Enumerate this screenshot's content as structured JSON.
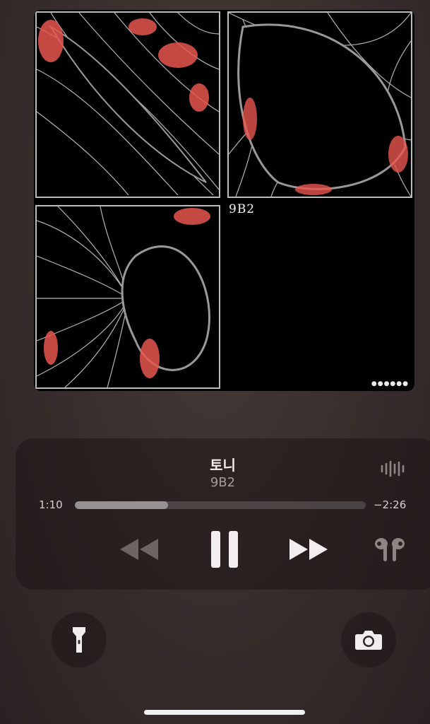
{
  "artwork": {
    "label": "9B2",
    "corner_mark": "●●●●●●"
  },
  "now_playing": {
    "title": "토니",
    "artist": "9B2",
    "elapsed": "1:10",
    "remaining": "−2:26",
    "progress_fraction": 0.32,
    "state": "playing"
  },
  "icons": {
    "audio": "waveform-icon",
    "rewind": "backward-icon",
    "play_pause": "pause-icon",
    "forward": "forward-icon",
    "output": "airpods-icon",
    "flashlight": "flashlight-icon",
    "camera": "camera-icon"
  },
  "colors": {
    "art_accent": "#e8564f",
    "art_line": "#c8c8c8"
  }
}
